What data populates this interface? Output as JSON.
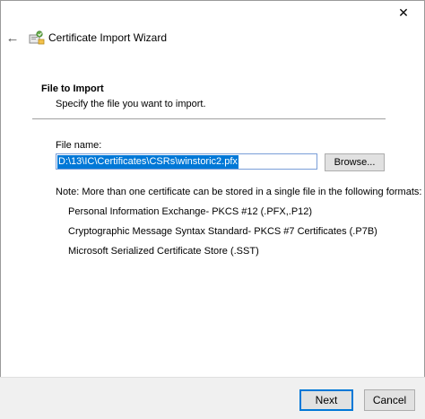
{
  "window": {
    "title": "Certificate Import Wizard",
    "close_glyph": "✕",
    "back_glyph": "←"
  },
  "section": {
    "title": "File to Import",
    "description": "Specify the file you want to import."
  },
  "file": {
    "label": "File name:",
    "value": "D:\\13\\IC\\Certificates\\CSRs\\winstoric2.pfx",
    "browse_label": "Browse..."
  },
  "note": "Note:  More than one certificate can be stored in a single file in the following formats:",
  "formats": [
    "Personal Information Exchange- PKCS #12 (.PFX,.P12)",
    "Cryptographic Message Syntax Standard- PKCS #7 Certificates (.P7B)",
    "Microsoft Serialized Certificate Store (.SST)"
  ],
  "footer": {
    "next_label": "Next",
    "cancel_label": "Cancel"
  },
  "colors": {
    "accent": "#0078d7",
    "button_bg": "#e1e1e1",
    "footer_bg": "#f0f0f0"
  },
  "icons": {
    "close": "close-icon",
    "back": "back-arrow-icon",
    "wizard": "certificate-wizard-icon"
  }
}
